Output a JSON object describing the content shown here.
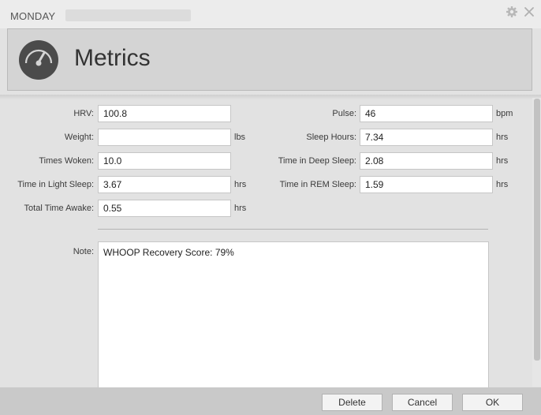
{
  "window": {
    "day": "MONDAY",
    "title": "Metrics",
    "icons": {
      "settings": "gear-icon",
      "close": "close-icon",
      "header": "gauge-icon"
    }
  },
  "fields": {
    "hrv": {
      "label": "HRV:",
      "value": "100.8",
      "unit": ""
    },
    "weight": {
      "label": "Weight:",
      "value": "",
      "unit": "lbs"
    },
    "times_woken": {
      "label": "Times Woken:",
      "value": "10.0",
      "unit": ""
    },
    "light_sleep": {
      "label": "Time in Light Sleep:",
      "value": "3.67",
      "unit": "hrs"
    },
    "time_awake": {
      "label": "Total Time Awake:",
      "value": "0.55",
      "unit": "hrs"
    },
    "pulse": {
      "label": "Pulse:",
      "value": "46",
      "unit": "bpm"
    },
    "sleep_hours": {
      "label": "Sleep Hours:",
      "value": "7.34",
      "unit": "hrs"
    },
    "deep_sleep": {
      "label": "Time in Deep Sleep:",
      "value": "2.08",
      "unit": "hrs"
    },
    "rem_sleep": {
      "label": "Time in REM Sleep:",
      "value": "1.59",
      "unit": "hrs"
    }
  },
  "note": {
    "label": "Note:",
    "value": "WHOOP Recovery Score: 79%"
  },
  "buttons": {
    "delete": "Delete",
    "cancel": "Cancel",
    "ok": "OK"
  }
}
